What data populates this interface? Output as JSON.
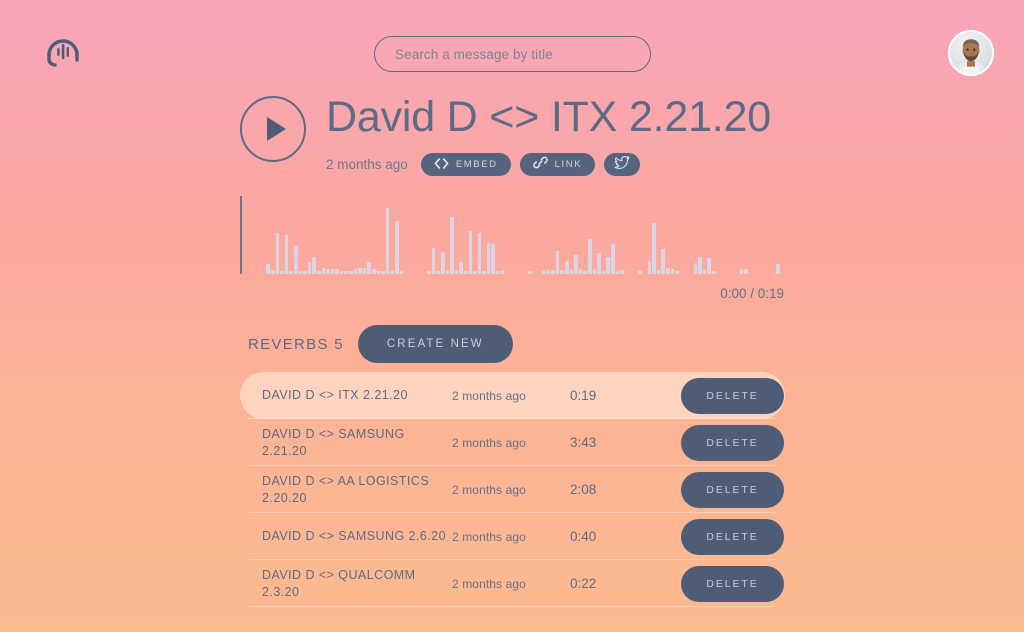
{
  "header": {
    "logo_icon": "headset-waveform-icon",
    "search": {
      "placeholder": "Search a message by title",
      "value": ""
    },
    "avatar_alt": "user-avatar"
  },
  "episode": {
    "title": "David D <> ITX 2.21.20",
    "age": "2 months ago",
    "play_icon": "play-triangle-icon",
    "actions": [
      {
        "label": "EMBED",
        "icon": "code-brackets-icon",
        "name": "embed-button"
      },
      {
        "label": "LINK",
        "icon": "chain-link-icon",
        "name": "link-button"
      },
      {
        "label": "",
        "icon": "twitter-bird-icon",
        "name": "twitter-share-button"
      }
    ]
  },
  "player": {
    "current_time": "0:00",
    "total_time": "0:19",
    "time_display": "0:00 / 0:19",
    "playhead_position_pct": 0,
    "waveform": {
      "bar_color": "#d7d9ec",
      "peaks": [
        0.0,
        0.0,
        0.0,
        0.0,
        0.13,
        0.05,
        0.52,
        0.03,
        0.5,
        0.04,
        0.36,
        0.03,
        0.03,
        0.16,
        0.22,
        0.04,
        0.08,
        0.07,
        0.07,
        0.07,
        0.03,
        0.03,
        0.02,
        0.07,
        0.08,
        0.08,
        0.15,
        0.07,
        0.02,
        0.02,
        0.85,
        0.03,
        0.68,
        0.02,
        0.0,
        0.0,
        0.0,
        0.0,
        0.0,
        0.03,
        0.33,
        0.03,
        0.28,
        0.04,
        0.73,
        0.04,
        0.15,
        0.03,
        0.55,
        0.04,
        0.52,
        0.04,
        0.4,
        0.38,
        0.03,
        0.05,
        0.0,
        0.0,
        0.0,
        0.0,
        0.0,
        0.04,
        0.0,
        0.0,
        0.03,
        0.05,
        0.05,
        0.3,
        0.05,
        0.17,
        0.07,
        0.25,
        0.06,
        0.03,
        0.45,
        0.07,
        0.27,
        0.04,
        0.22,
        0.38,
        0.04,
        0.05,
        0.0,
        0.0,
        0.0,
        0.03,
        0.0,
        0.17,
        0.65,
        0.05,
        0.32,
        0.08,
        0.06,
        0.03,
        0.0,
        0.0,
        0.0,
        0.14,
        0.22,
        0.05,
        0.2,
        0.03,
        0.0,
        0.0,
        0.0,
        0.0,
        0.0,
        0.07,
        0.07,
        0.0,
        0.0,
        0.0,
        0.0,
        0.0,
        0.0,
        0.13,
        0.0,
        0.0
      ]
    }
  },
  "reverbs": {
    "section_title": "REVERBS 5",
    "count": 5,
    "create_label": "CREATE NEW",
    "delete_label": "DELETE",
    "items": [
      {
        "name": "DAVID D <> ITX 2.21.20",
        "age": "2 months ago",
        "duration": "0:19",
        "active": true
      },
      {
        "name": "DAVID D <> SAMSUNG 2.21.20",
        "age": "2 months ago",
        "duration": "3:43",
        "active": false
      },
      {
        "name": "DAVID D <> AA LOGISTICS 2.20.20",
        "age": "2 months ago",
        "duration": "2:08",
        "active": false
      },
      {
        "name": "DAVID D <> SAMSUNG 2.6.20",
        "age": "2 months ago",
        "duration": "0:40",
        "active": false
      },
      {
        "name": "DAVID D <> QUALCOMM 2.3.20",
        "age": "2 months ago",
        "duration": "0:22",
        "active": false
      }
    ]
  },
  "theme": {
    "bg_top": "#f9a5ba",
    "bg_bottom": "#fcba8f",
    "slate": "#4e5d75",
    "text": "#5d6a85",
    "wave": "#d7d9ec",
    "row_active_bg": "#fccdb8"
  }
}
